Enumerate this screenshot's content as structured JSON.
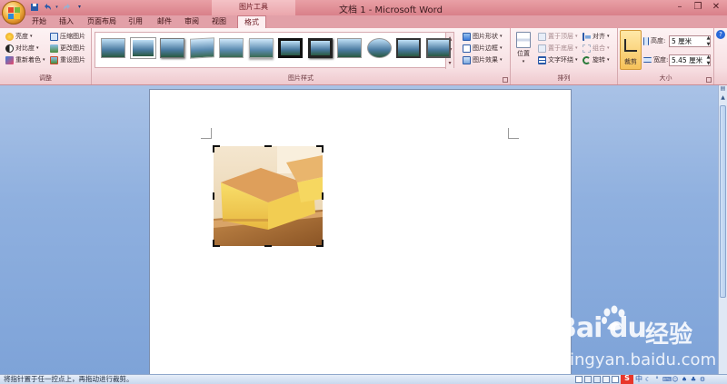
{
  "window": {
    "title": "文档 1 - Microsoft Word",
    "context_tool": "图片工具"
  },
  "quick_access": [
    "save-icon",
    "undo-icon",
    "redo-icon",
    "customize-icon"
  ],
  "tabs": [
    {
      "label": "开始"
    },
    {
      "label": "插入"
    },
    {
      "label": "页面布局"
    },
    {
      "label": "引用"
    },
    {
      "label": "邮件"
    },
    {
      "label": "审阅"
    },
    {
      "label": "视图"
    },
    {
      "label": "格式",
      "active": true
    }
  ],
  "ribbon": {
    "adjust": {
      "label": "调整",
      "brightness": "亮度",
      "contrast": "对比度",
      "recolor": "重新着色",
      "compress": "压缩图片",
      "change": "更改图片",
      "reset": "重设图片"
    },
    "styles": {
      "label": "图片样式",
      "shape": "图片形状",
      "border": "图片边框",
      "effects": "图片效果",
      "thumb_count": 12
    },
    "arrange": {
      "label": "排列",
      "position": "位置",
      "bring_front": "置于顶层",
      "send_back": "置于底层",
      "text_wrap": "文字环绕",
      "align": "对齐",
      "group": "组合",
      "rotate": "旋转"
    },
    "size": {
      "label": "大小",
      "crop": "裁剪",
      "height_label": "高度:",
      "height_value": "5 厘米",
      "width_label": "宽度:",
      "width_value": "5.45 厘米"
    }
  },
  "status": {
    "text": "将指针置于任一控点上，再拖动进行裁剪。"
  },
  "watermark": {
    "brand": "Bai",
    "brand_du": "du",
    "brand_cn": "经验",
    "url": "jingyan.baidu.com"
  },
  "colors": {
    "title_bar": "#e2a0a8",
    "ribbon": "#fdeef0",
    "doc_background": "#8fb0df"
  }
}
